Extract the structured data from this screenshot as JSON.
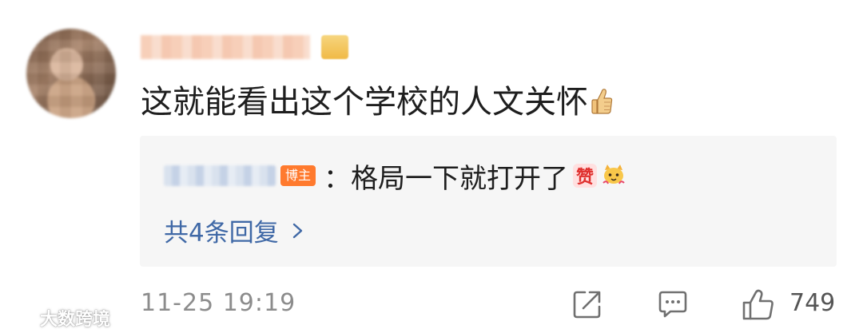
{
  "comment": {
    "text": "这就能看出这个学校的人文关怀",
    "emoji": "thumbs-up-emoji"
  },
  "reply": {
    "author_tag": "博主",
    "text": "：格局一下就打开了",
    "emojis": [
      "zan-emoji",
      "cat-emoji"
    ],
    "more_label": "共4条回复"
  },
  "footer": {
    "timestamp": "11-25 19:19",
    "like_count": "749",
    "icons": [
      "share-icon",
      "reply-icon",
      "like-icon"
    ]
  },
  "watermark": {
    "text": "大数跨境"
  },
  "colors": {
    "link_blue": "#3f68a6",
    "blogger_tag": "#ff7a2e",
    "reply_bg": "#f6f6f6",
    "meta_gray": "#8c8c8c"
  }
}
